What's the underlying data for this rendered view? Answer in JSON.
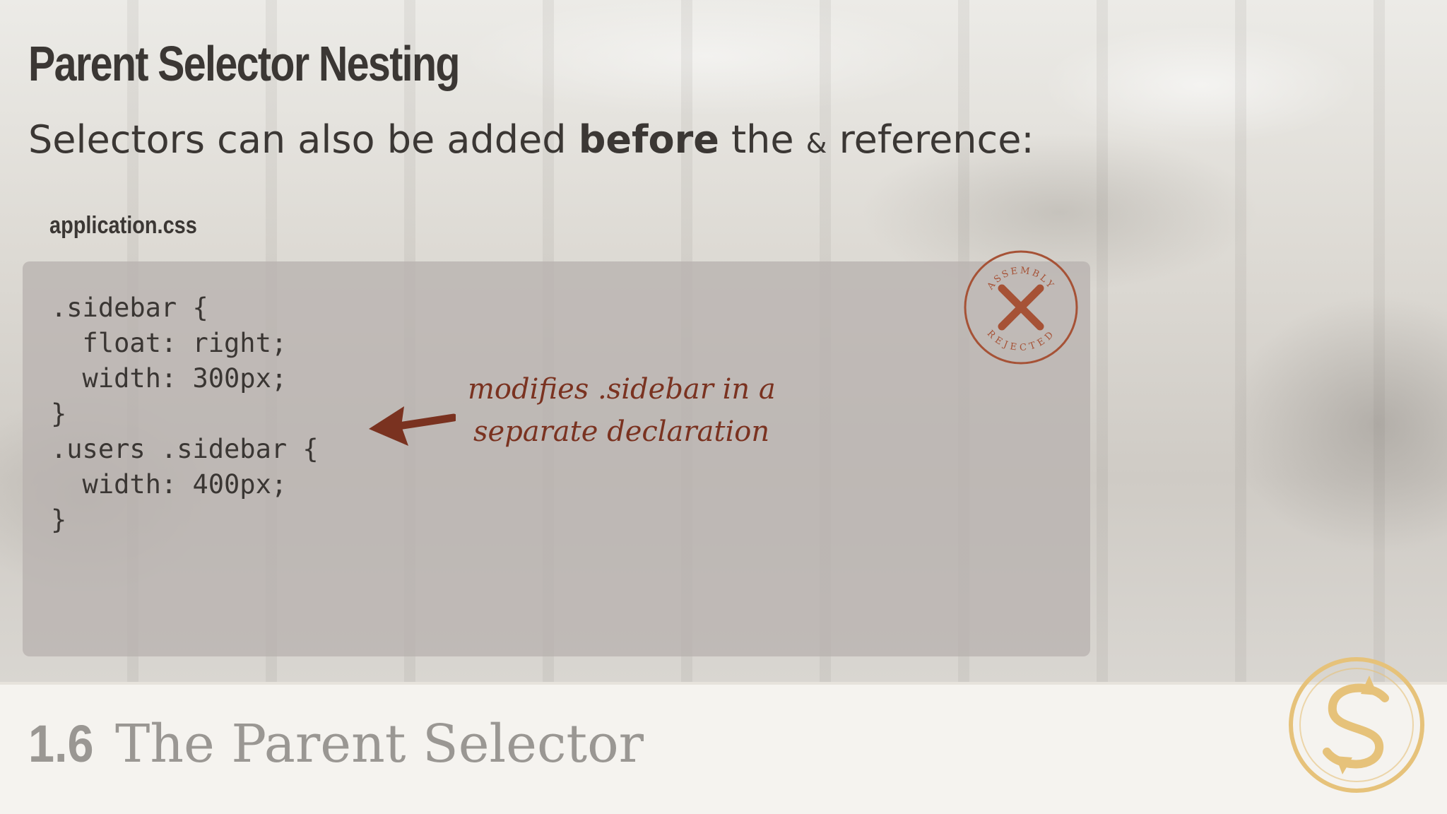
{
  "slide": {
    "title": "Parent Selector Nesting",
    "subtitle": {
      "part1": "Selectors can also be added ",
      "emphasis": "before",
      "part2": " the ",
      "amp": "&",
      "part3": " reference:"
    },
    "filename": "application.css"
  },
  "code": {
    "lines": [
      ".sidebar {",
      "  float: right;",
      "  width: 300px;",
      "}",
      ".users .sidebar {",
      "  width: 400px;",
      "}"
    ]
  },
  "annotation": {
    "line1": "modifies .sidebar in a",
    "line2": "separate declaration"
  },
  "stamp": {
    "top_text": "ASSEMBLY",
    "bottom_text": "REJECTED",
    "color": "#a65236"
  },
  "footer": {
    "section_number": "1.6",
    "section_title": "The Parent Selector"
  },
  "colors": {
    "text": "#3b3734",
    "accent": "#7a3220",
    "footer_text": "#9a9793",
    "logo": "#e6c27a"
  },
  "icons": {
    "arrow": "arrow-left-icon",
    "stamp": "rejected-stamp-icon",
    "logo": "s-logo-icon"
  }
}
